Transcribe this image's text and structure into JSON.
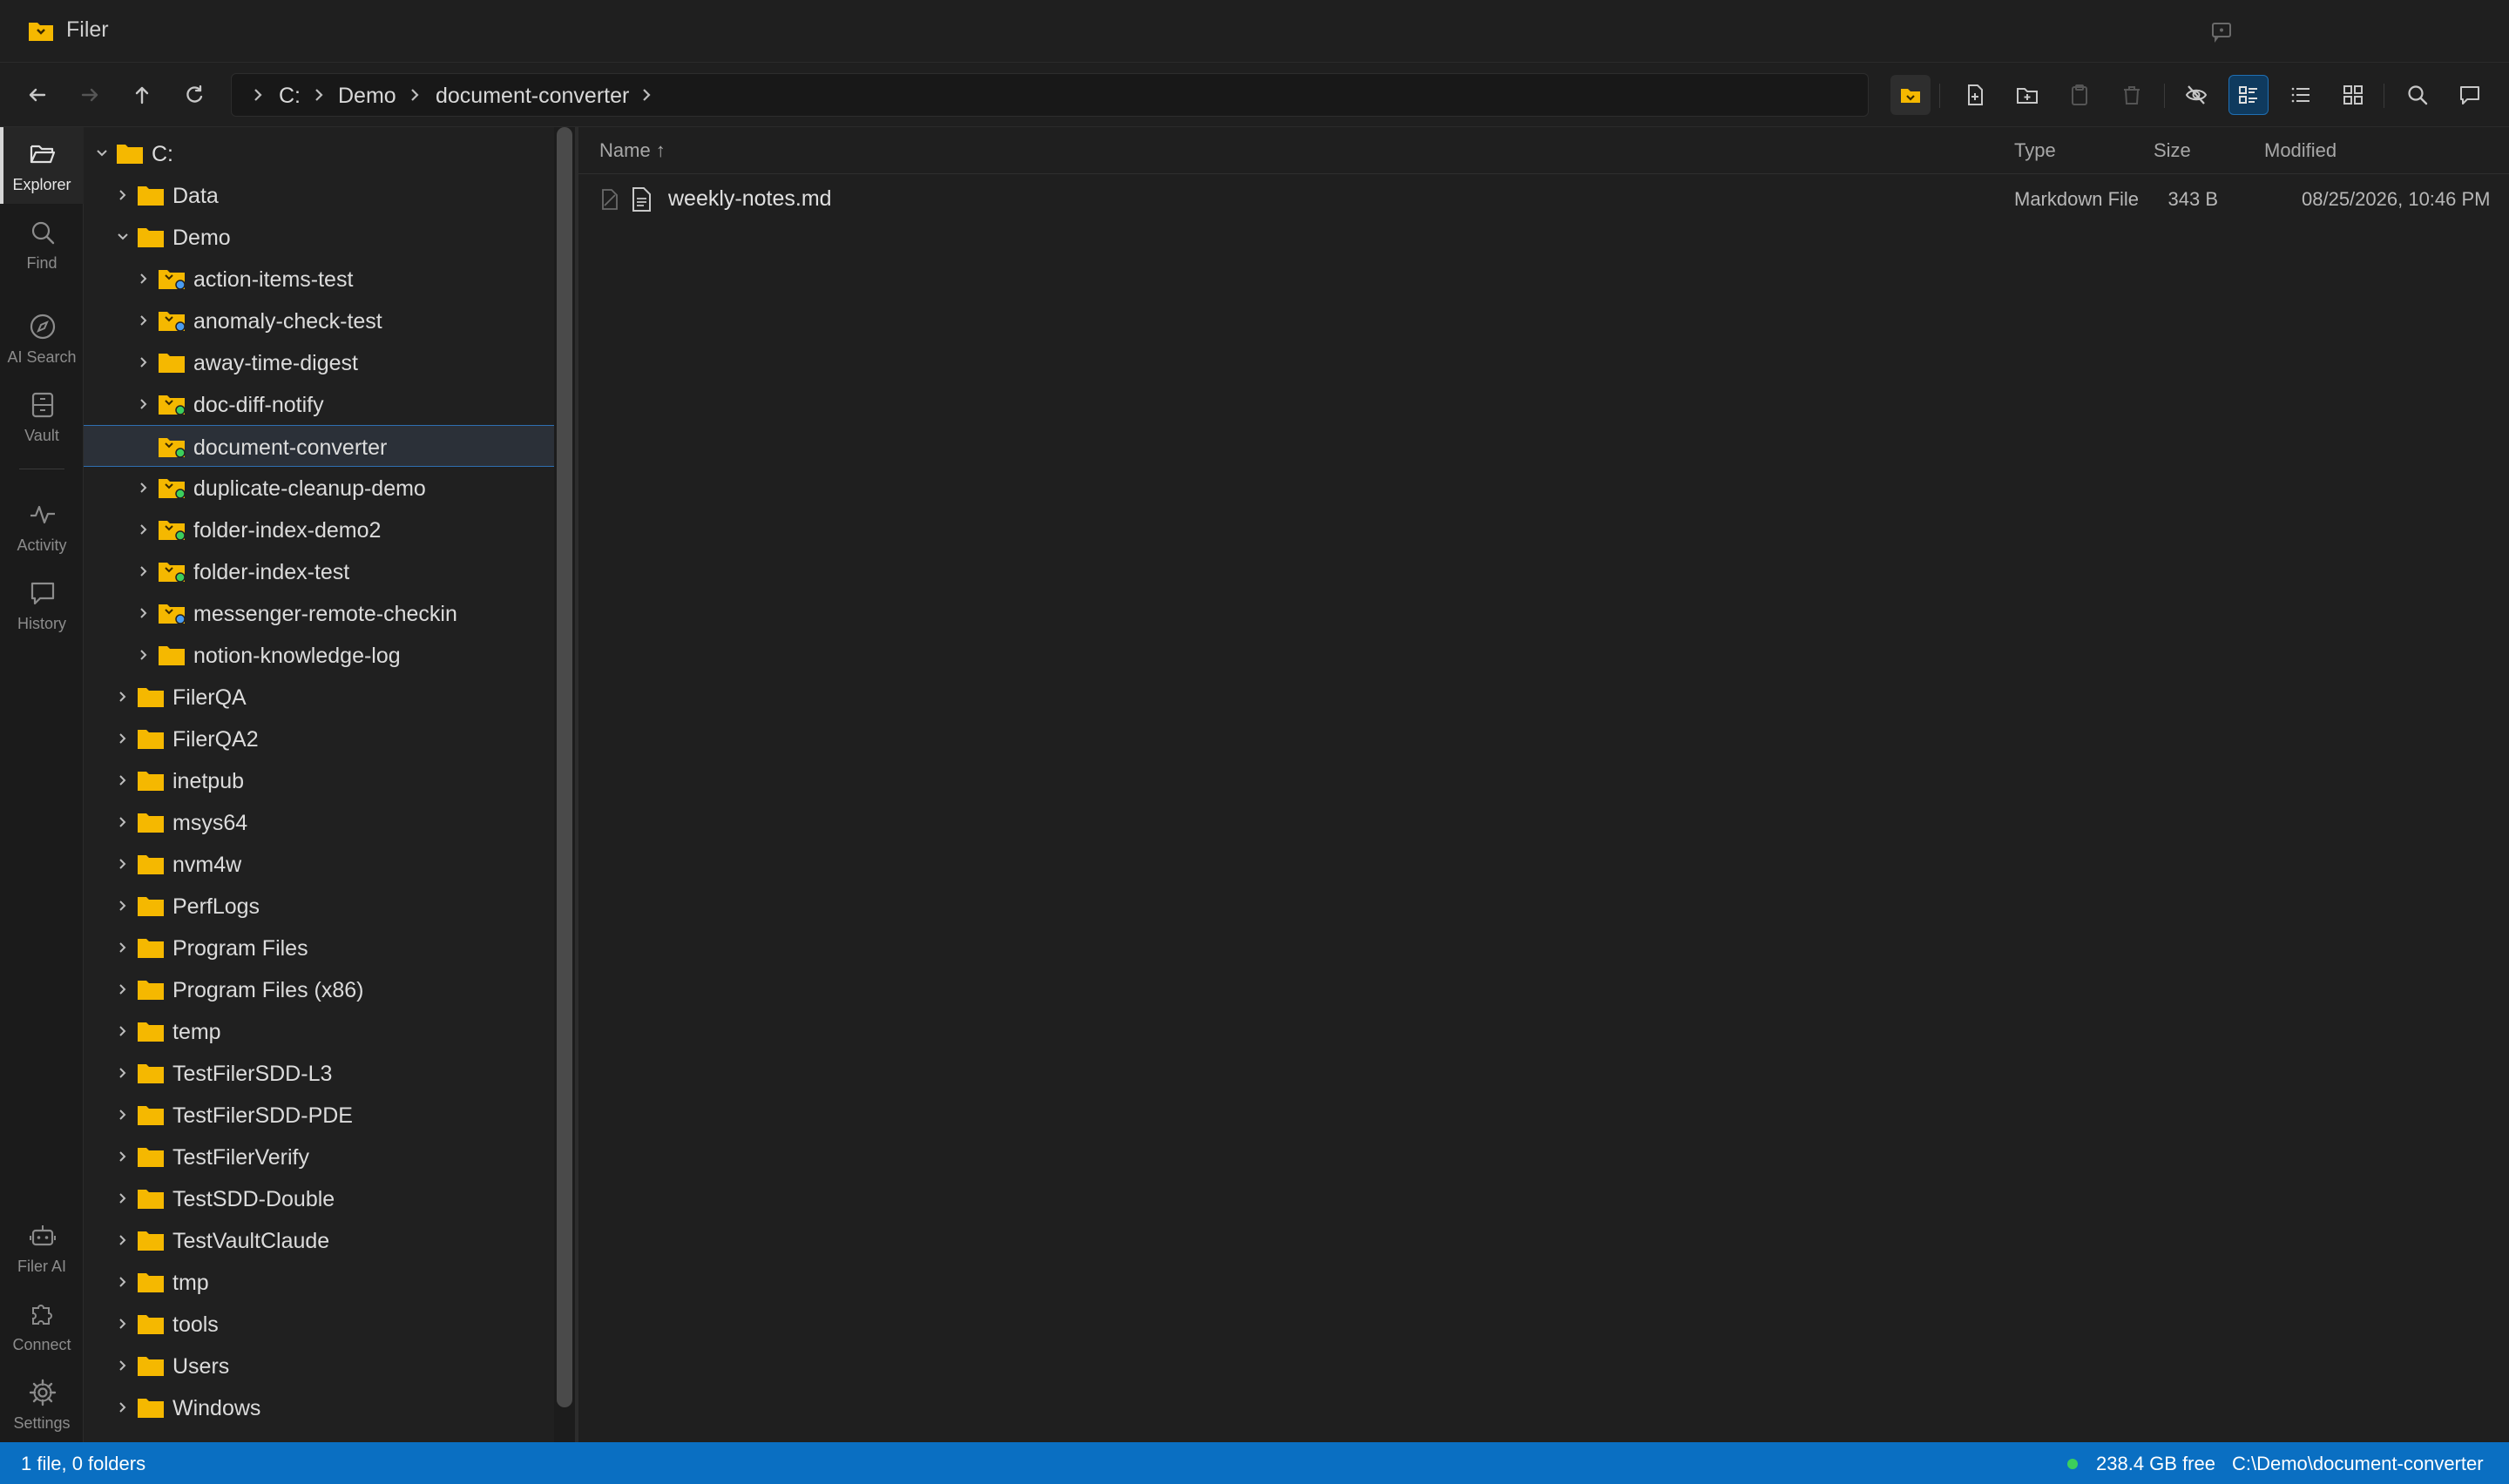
{
  "app": {
    "title": "Filer",
    "icon": "folder-app-icon"
  },
  "toolbar": {
    "buttons": [
      "back-icon",
      "forward-icon",
      "up-icon",
      "refresh-icon"
    ],
    "actions": [
      "open-folder-icon",
      "new-file-icon",
      "new-folder-icon",
      "paste-icon",
      "delete-icon",
      "hide-hidden-icon",
      "details-view-icon",
      "list-view-icon",
      "grid-view-icon",
      "search-icon",
      "chat-icon"
    ]
  },
  "breadcrumb": [
    "C:",
    "Demo",
    "document-converter"
  ],
  "activity": [
    {
      "label": "Explorer",
      "icon": "folder-open-icon",
      "active": true
    },
    {
      "label": "Find",
      "icon": "search-icon"
    },
    {
      "label": "AI Search",
      "icon": "compass-icon"
    },
    {
      "label": "Vault",
      "icon": "vault-icon"
    },
    {
      "label": "Activity",
      "icon": "pulse-icon"
    },
    {
      "label": "History",
      "icon": "message-icon"
    },
    {
      "label": "Filer AI",
      "icon": "robot-icon"
    },
    {
      "label": "Connect",
      "icon": "puzzle-icon"
    },
    {
      "label": "Settings",
      "icon": "gear-icon"
    }
  ],
  "tree": [
    {
      "label": "C:",
      "level": 0,
      "expanded": true
    },
    {
      "label": "Data",
      "level": 1
    },
    {
      "label": "Demo",
      "level": 1,
      "expanded": true
    },
    {
      "label": "action-items-test",
      "level": 2,
      "badge": "blue"
    },
    {
      "label": "anomaly-check-test",
      "level": 2,
      "badge": "blue"
    },
    {
      "label": "away-time-digest",
      "level": 2
    },
    {
      "label": "doc-diff-notify",
      "level": 2,
      "badge": "green"
    },
    {
      "label": "document-converter",
      "level": 2,
      "badge": "green",
      "selected": true,
      "noChevron": true
    },
    {
      "label": "duplicate-cleanup-demo",
      "level": 2,
      "badge": "green"
    },
    {
      "label": "folder-index-demo2",
      "level": 2,
      "badge": "green"
    },
    {
      "label": "folder-index-test",
      "level": 2,
      "badge": "green"
    },
    {
      "label": "messenger-remote-checkin",
      "level": 2,
      "badge": "blue"
    },
    {
      "label": "notion-knowledge-log",
      "level": 2
    },
    {
      "label": "FilerQA",
      "level": 1
    },
    {
      "label": "FilerQA2",
      "level": 1
    },
    {
      "label": "inetpub",
      "level": 1
    },
    {
      "label": "msys64",
      "level": 1
    },
    {
      "label": "nvm4w",
      "level": 1
    },
    {
      "label": "PerfLogs",
      "level": 1
    },
    {
      "label": "Program Files",
      "level": 1
    },
    {
      "label": "Program Files (x86)",
      "level": 1
    },
    {
      "label": "temp",
      "level": 1
    },
    {
      "label": "TestFilerSDD-L3",
      "level": 1
    },
    {
      "label": "TestFilerSDD-PDE",
      "level": 1
    },
    {
      "label": "TestFilerVerify",
      "level": 1
    },
    {
      "label": "TestSDD-Double",
      "level": 1
    },
    {
      "label": "TestVaultClaude",
      "level": 1
    },
    {
      "label": "tmp",
      "level": 1
    },
    {
      "label": "tools",
      "level": 1
    },
    {
      "label": "Users",
      "level": 1
    },
    {
      "label": "Windows",
      "level": 1
    }
  ],
  "filelist": {
    "columns": {
      "name": "Name ↑",
      "type": "Type",
      "size": "Size",
      "modified": "Modified"
    },
    "rows": [
      {
        "name": "weekly-notes.md",
        "type": "Markdown File",
        "size": "343 B",
        "modified": "08/25/2026, 10:46 PM"
      }
    ]
  },
  "status": {
    "summary": "1 file, 0 folders",
    "free": "238.4 GB free",
    "path": "C:\\Demo\\document-converter"
  },
  "colors": {
    "accent": "#0a6fc2",
    "folder": "#f5b800",
    "badge_blue": "#4a9cf0",
    "badge_green": "#3ccf5c"
  }
}
